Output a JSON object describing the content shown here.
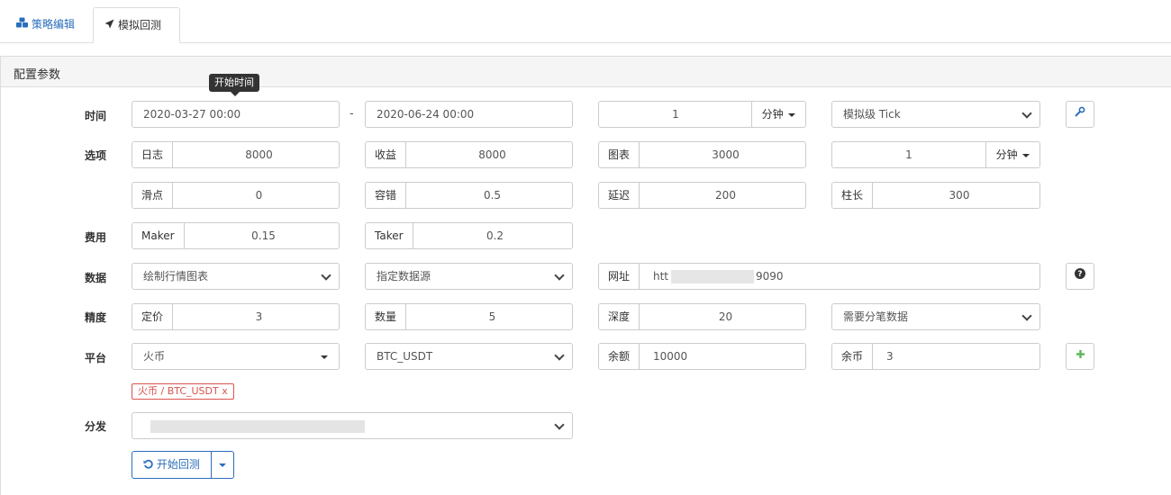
{
  "tabs": [
    {
      "label": "策略编辑",
      "icon": "cubes-icon"
    },
    {
      "label": "模拟回测",
      "icon": "rocket-icon"
    }
  ],
  "panel": {
    "title": "配置参数"
  },
  "tooltip": "开始时间",
  "rows": {
    "time": "时间",
    "options": "选项",
    "fee": "费用",
    "data": "数据",
    "precision": "精度",
    "platform": "平台",
    "distribute": "分发"
  },
  "time": {
    "start": "2020-03-27 00:00",
    "separator": "-",
    "end": "2020-06-24 00:00",
    "period_value": "1",
    "period_unit": "分钟",
    "mode": "模拟级 Tick"
  },
  "options": {
    "log_label": "日志",
    "log_value": "8000",
    "profit_label": "收益",
    "profit_value": "8000",
    "chart_label": "图表",
    "chart_value": "3000",
    "kline_value": "1",
    "kline_unit": "分钟",
    "slippage_label": "滑点",
    "slippage_value": "0",
    "tolerance_label": "容错",
    "tolerance_value": "0.5",
    "delay_label": "延迟",
    "delay_value": "200",
    "bar_label": "柱长",
    "bar_value": "300"
  },
  "fee": {
    "maker_label": "Maker",
    "maker_value": "0.15",
    "taker_label": "Taker",
    "taker_value": "0.2"
  },
  "data": {
    "chart_select": "绘制行情图表",
    "source_select": "指定数据源",
    "url_label": "网址",
    "url_prefix": "htt",
    "url_suffix": "9090"
  },
  "precision": {
    "price_label": "定价",
    "price_value": "3",
    "amount_label": "数量",
    "amount_value": "5",
    "depth_label": "深度",
    "depth_value": "20",
    "tick_select": "需要分笔数据"
  },
  "platform": {
    "exchange": "火币",
    "pair": "BTC_USDT",
    "balance_label": "余额",
    "balance_value": "10000",
    "coins_label": "余币",
    "coins_value": "3",
    "tag": "火币 / BTC_USDT  x"
  },
  "actions": {
    "start": "开始回测"
  }
}
